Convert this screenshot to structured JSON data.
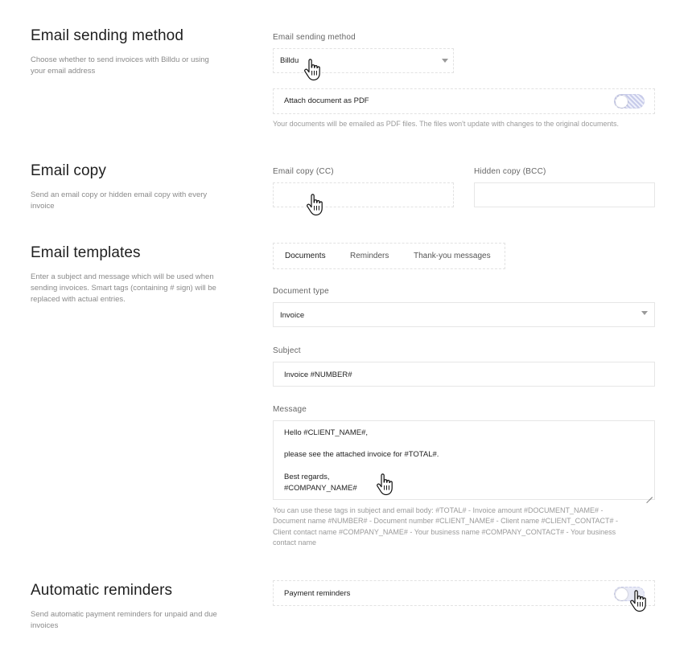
{
  "sending": {
    "title": "Email sending method",
    "description": "Choose whether to send invoices with Billdu or using your email address",
    "field_label": "Email sending method",
    "selected": "Billdu",
    "attach_label": "Attach document as PDF",
    "attach_help": "Your documents will be emailed as PDF files. The files won't update with changes to the original documents."
  },
  "copy": {
    "title": "Email copy",
    "description": "Send an email copy or hidden email copy with every invoice",
    "cc_label": "Email copy (CC)",
    "cc_value": "",
    "bcc_label": "Hidden copy (BCC)",
    "bcc_value": ""
  },
  "templates": {
    "title": "Email templates",
    "description": "Enter a subject and message which will be used when sending invoices. Smart tags (containing # sign) will be replaced with actual entries.",
    "tabs": [
      "Documents",
      "Reminders",
      "Thank-you messages"
    ],
    "doc_type_label": "Document type",
    "doc_type_value": "Invoice",
    "subject_label": "Subject",
    "subject_value": "Invoice #NUMBER#",
    "message_label": "Message",
    "message_lines": [
      "Hello #CLIENT_NAME#,",
      "please see the attached invoice for #TOTAL#.",
      "Best regards,",
      "#COMPANY_NAME#"
    ],
    "tags_help_lines": [
      "You can use these tags in subject and email body: #TOTAL# - Invoice amount #DOCUMENT_NAME# -",
      "Document name #NUMBER# - Document number #CLIENT_NAME# - Client name #CLIENT_CONTACT# -",
      "Client contact name #COMPANY_NAME# - Your business name #COMPANY_CONTACT# - Your business",
      "contact name"
    ]
  },
  "reminders": {
    "title": "Automatic reminders",
    "description": "Send automatic payment reminders for unpaid and due invoices",
    "payment_label": "Payment reminders"
  },
  "icons": {
    "dropdown": "caret-down-icon",
    "cursor": "hand-pointer-icon"
  },
  "colors": {
    "toggle_track": "#e8eaf6",
    "label": "#666666",
    "help": "#9a9a9a"
  }
}
